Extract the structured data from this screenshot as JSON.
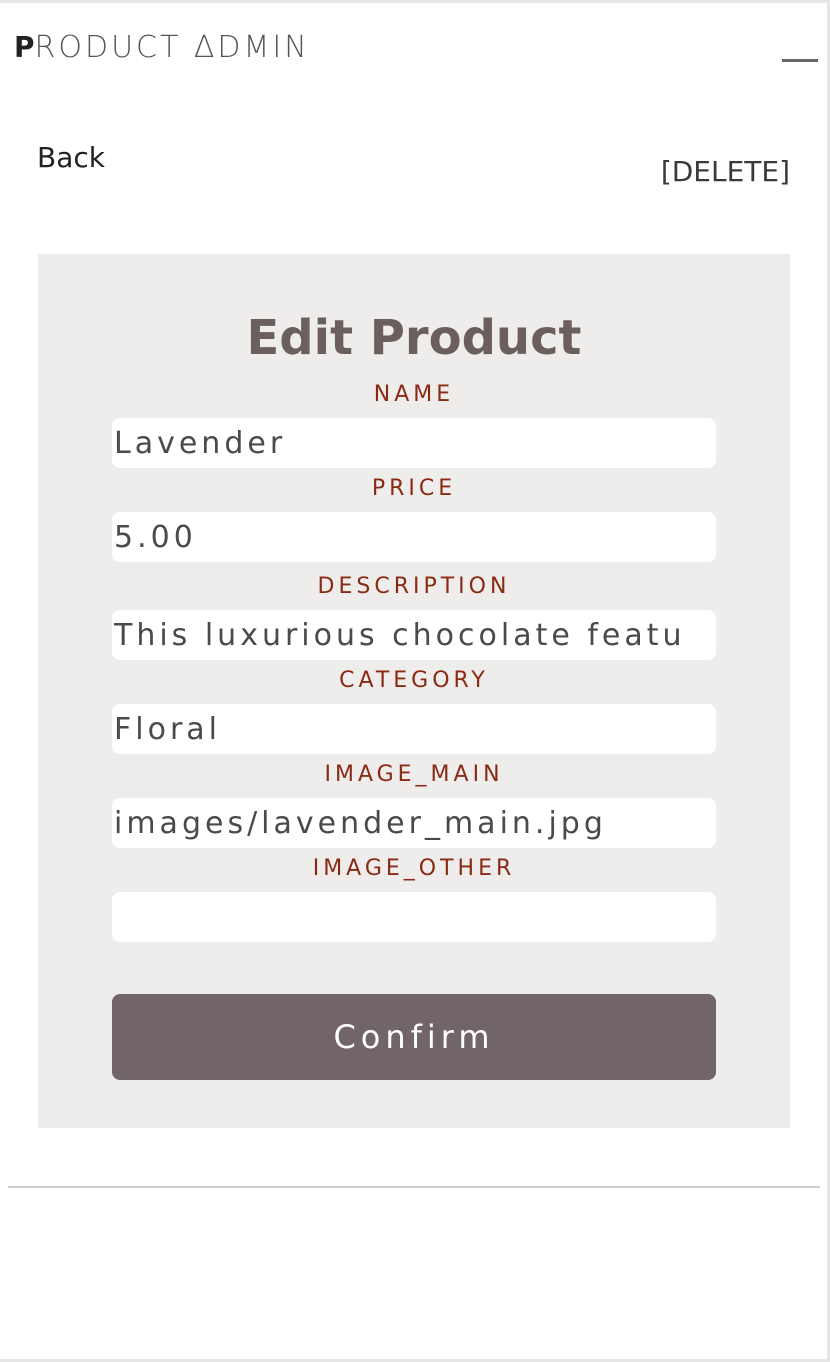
{
  "header": {
    "brand_first": "P",
    "brand_rest": "RODUCT ∆DMIN"
  },
  "nav": {
    "back_label": "Back",
    "delete_label": "[DELETE]"
  },
  "form": {
    "title": "Edit Product",
    "fields": [
      {
        "label": "NAME",
        "value": "Lavender"
      },
      {
        "label": "PRICE",
        "value": "5.00"
      },
      {
        "label": "DESCRIPTION",
        "value": "This luxurious chocolate featu"
      },
      {
        "label": "CATEGORY",
        "value": "Floral"
      },
      {
        "label": "IMAGE_MAIN",
        "value": "images/lavender_main.jpg"
      },
      {
        "label": "IMAGE_OTHER",
        "value": ""
      }
    ],
    "confirm_label": "Confirm"
  },
  "colors": {
    "label": "#8b2a14",
    "title": "#6b5e5f",
    "card_bg": "#efedec",
    "button_bg": "#716568"
  },
  "icons": {
    "menu": "menu-icon"
  }
}
